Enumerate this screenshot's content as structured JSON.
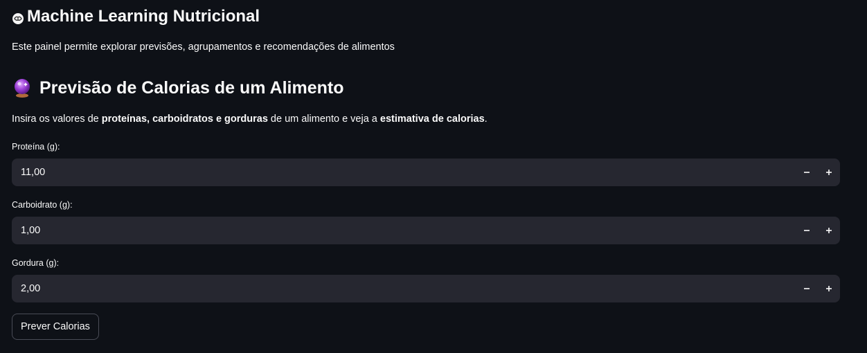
{
  "header": {
    "title": "Machine Learning Nutricional",
    "title_icon": "brain-icon",
    "intro": "Este painel permite explorar previsões, agrupamentos e recomendações de alimentos"
  },
  "section": {
    "title": "Previsão de Calorias de um Alimento",
    "title_icon": "crystal-ball-icon",
    "desc_prefix": "Insira os valores de ",
    "desc_bold_1": "proteínas, carboidratos e gorduras",
    "desc_middle": " de um alimento e veja a ",
    "desc_bold_2": "estimativa de calorias",
    "desc_suffix": "."
  },
  "inputs": [
    {
      "label": "Proteína (g):",
      "value": "11,00"
    },
    {
      "label": "Carboidrato (g):",
      "value": "1,00"
    },
    {
      "label": "Gordura (g):",
      "value": "2,00"
    }
  ],
  "stepper": {
    "minus": "−",
    "plus": "+"
  },
  "predict_button": {
    "label": "Prever Calorias"
  },
  "colors": {
    "background": "#0e1117",
    "input_bg": "#262730",
    "text": "#fafafa",
    "ball_purple": "#8e44ad"
  }
}
